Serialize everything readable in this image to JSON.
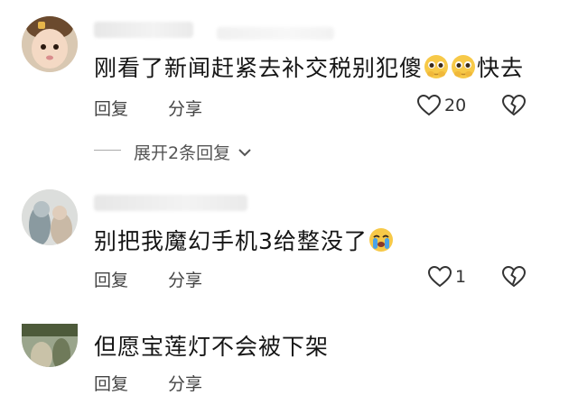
{
  "comments": [
    {
      "text": "刚看了新闻赶紧去补交税别犯傻",
      "text_tail": "快去",
      "reply_label": "回复",
      "share_label": "分享",
      "like_count": "20",
      "icons": [
        "heart-outline-icon",
        "broken-heart-icon",
        "pleading-face-emoji"
      ],
      "expand_label": "展开2条回复"
    },
    {
      "text": "别把我魔幻手机3给整没了",
      "reply_label": "回复",
      "share_label": "分享",
      "like_count": "1",
      "icons": [
        "heart-outline-icon",
        "broken-heart-icon",
        "crying-face-emoji"
      ]
    },
    {
      "text": "但愿宝莲灯不会被下架",
      "reply_label": "回复",
      "share_label": "分享"
    }
  ],
  "colors": {
    "text": "#161616",
    "secondary": "#444444",
    "emoji_yellow": "#f7c948",
    "emoji_tear": "#4aa3e8"
  }
}
